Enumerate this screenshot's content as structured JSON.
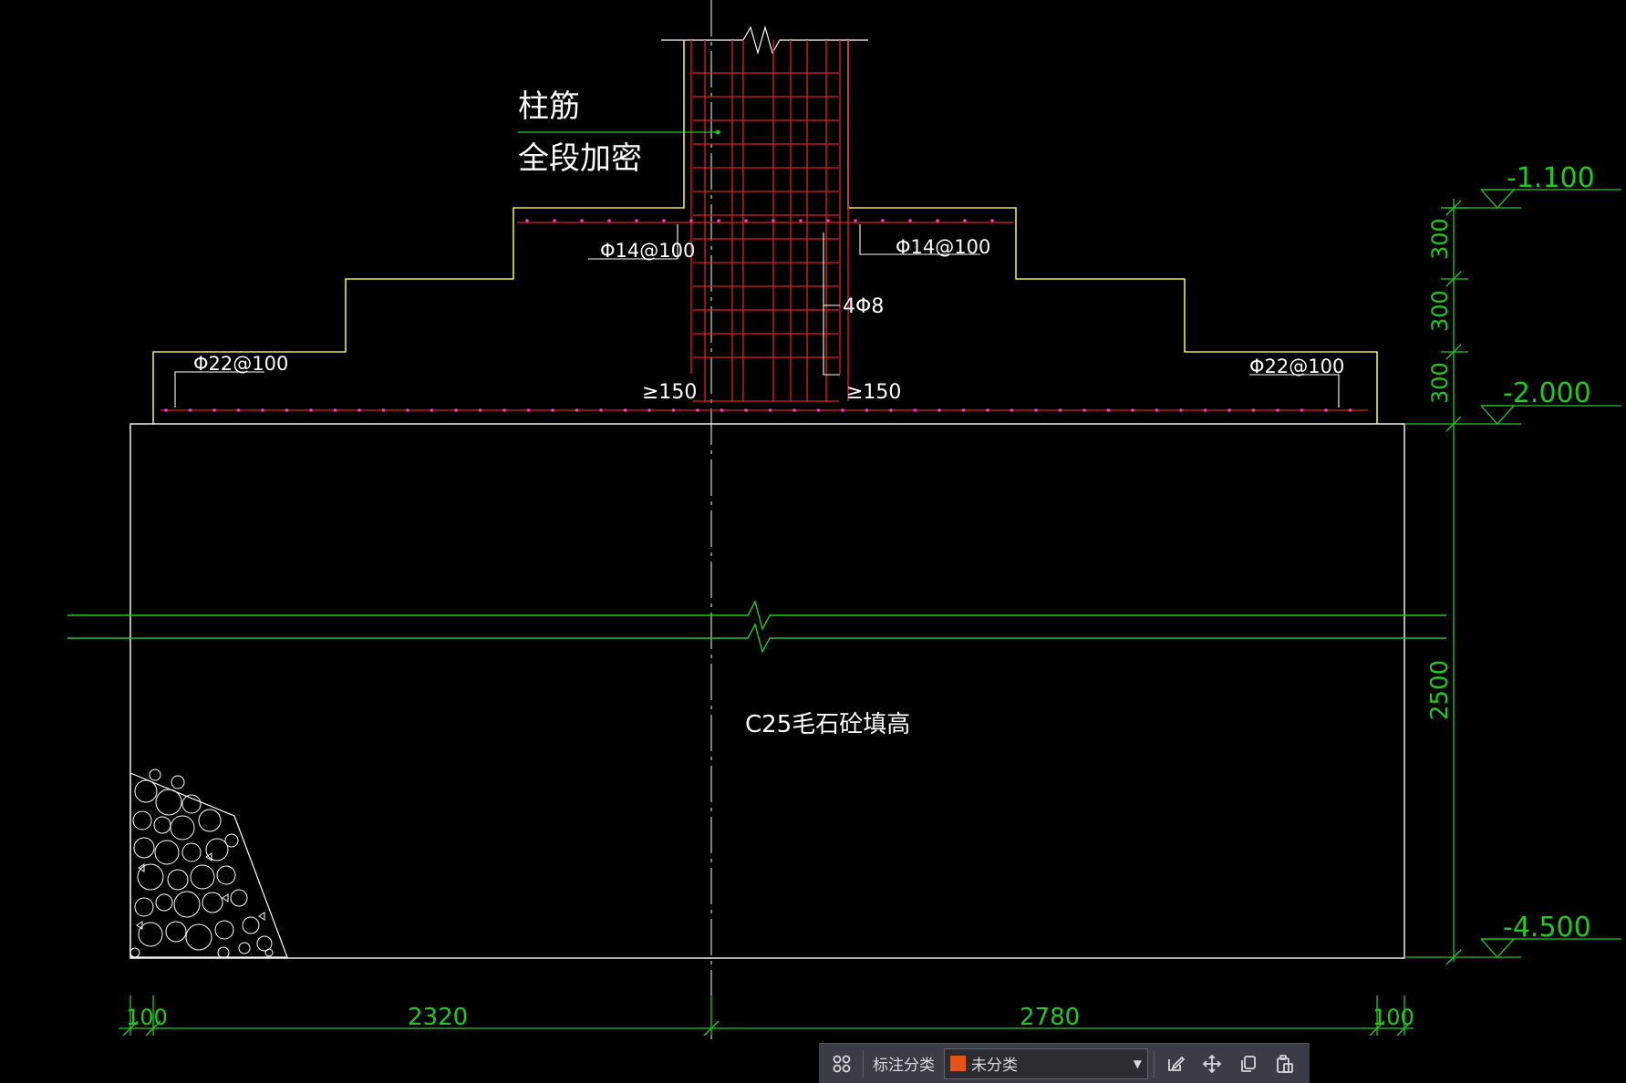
{
  "drawing": {
    "labels": {
      "column_rebar": "柱筋",
      "full_densify": "全段加密",
      "rebar_left_upper": "Φ14@100",
      "rebar_right_upper": "Φ14@100",
      "stirrups": "4Φ8",
      "rebar_left_lower": "Φ22@100",
      "rebar_right_lower": "Φ22@100",
      "min_left": "≥150",
      "min_right": "≥150",
      "fill_note": "C25毛石砼填高"
    },
    "elevations": {
      "top": "-1.100",
      "mid": "-2.000",
      "bottom": "-4.500"
    },
    "vertical_dims": [
      "300",
      "300",
      "300",
      "2500"
    ],
    "horizontal_dims": [
      "100",
      "2320",
      "2780",
      "100"
    ]
  },
  "colors": {
    "outline": "#ffffff",
    "footing": "#e8e84a",
    "rebar": "#e02020",
    "rebar_dot": "#ff33cc",
    "dimension": "#22c822",
    "leader": "#22c822",
    "text": "#ffffff",
    "toolbar_swatch": "#e8531a"
  },
  "toolbar": {
    "category_label": "标注分类",
    "category_value": "未分类",
    "icons": [
      "grid-icon",
      "edit-icon",
      "move-icon",
      "copy-icon",
      "paste-icon"
    ]
  }
}
